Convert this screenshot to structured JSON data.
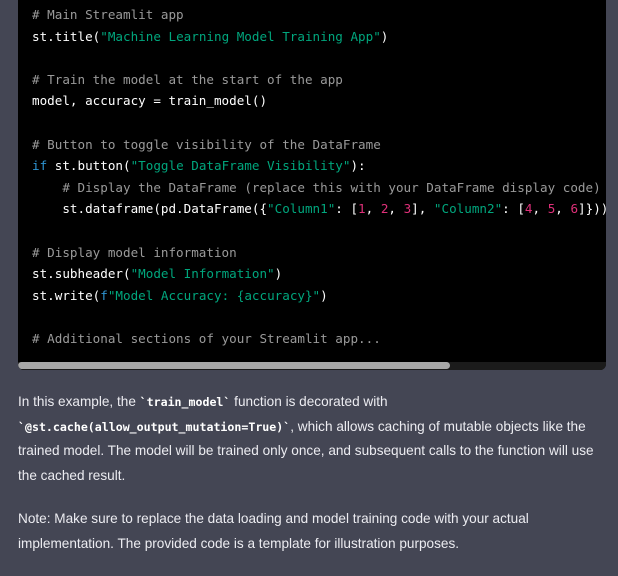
{
  "code_block": {
    "lines": [
      [
        {
          "t": "cm",
          "v": "# Main Streamlit app"
        }
      ],
      [
        {
          "t": "pl",
          "v": "st.title("
        },
        {
          "t": "str",
          "v": "\"Machine Learning Model Training App\""
        },
        {
          "t": "pl",
          "v": ")"
        }
      ],
      [],
      [
        {
          "t": "cm",
          "v": "# Train the model at the start of the app"
        }
      ],
      [
        {
          "t": "pl",
          "v": "model, accuracy = train_model()"
        }
      ],
      [],
      [
        {
          "t": "cm",
          "v": "# Button to toggle visibility of the DataFrame"
        }
      ],
      [
        {
          "t": "kw",
          "v": "if"
        },
        {
          "t": "pl",
          "v": " st.button("
        },
        {
          "t": "str",
          "v": "\"Toggle DataFrame Visibility\""
        },
        {
          "t": "pl",
          "v": "):"
        }
      ],
      [
        {
          "t": "pl",
          "v": "    "
        },
        {
          "t": "cm",
          "v": "# Display the DataFrame (replace this with your DataFrame display code)"
        }
      ],
      [
        {
          "t": "pl",
          "v": "    st.dataframe(pd.DataFrame({"
        },
        {
          "t": "str",
          "v": "\"Column1\""
        },
        {
          "t": "pl",
          "v": ": ["
        },
        {
          "t": "num",
          "v": "1"
        },
        {
          "t": "pl",
          "v": ", "
        },
        {
          "t": "num",
          "v": "2"
        },
        {
          "t": "pl",
          "v": ", "
        },
        {
          "t": "num",
          "v": "3"
        },
        {
          "t": "pl",
          "v": "], "
        },
        {
          "t": "str",
          "v": "\"Column2\""
        },
        {
          "t": "pl",
          "v": ": ["
        },
        {
          "t": "num",
          "v": "4"
        },
        {
          "t": "pl",
          "v": ", "
        },
        {
          "t": "num",
          "v": "5"
        },
        {
          "t": "pl",
          "v": ", "
        },
        {
          "t": "num",
          "v": "6"
        },
        {
          "t": "pl",
          "v": "]}))"
        }
      ],
      [],
      [
        {
          "t": "cm",
          "v": "# Display model information"
        }
      ],
      [
        {
          "t": "pl",
          "v": "st.subheader("
        },
        {
          "t": "str",
          "v": "\"Model Information\""
        },
        {
          "t": "pl",
          "v": ")"
        }
      ],
      [
        {
          "t": "pl",
          "v": "st.write("
        },
        {
          "t": "kw",
          "v": "f"
        },
        {
          "t": "str",
          "v": "\"Model Accuracy: {accuracy}\""
        },
        {
          "t": "pl",
          "v": ")"
        }
      ],
      [],
      [
        {
          "t": "cm",
          "v": "# Additional sections of your Streamlit app..."
        }
      ]
    ]
  },
  "prose": {
    "p1_a": "In this example, the ",
    "p1_code1": "`train_model`",
    "p1_b": " function is decorated with ",
    "p1_code2": "`@st.cache(allow_output_mutation=True)`",
    "p1_c": ", which allows caching of mutable objects like the trained model. The model will be trained only once, and subsequent calls to the function will use the cached result.",
    "p2": "Note: Make sure to replace the data loading and model training code with your actual implementation. The provided code is a template for illustration purposes."
  },
  "colors": {
    "page_bg": "#444654",
    "code_bg": "#000000",
    "comment": "#9a9a9a",
    "keyword": "#2e95d3",
    "string": "#00a67d",
    "number": "#df3079"
  }
}
